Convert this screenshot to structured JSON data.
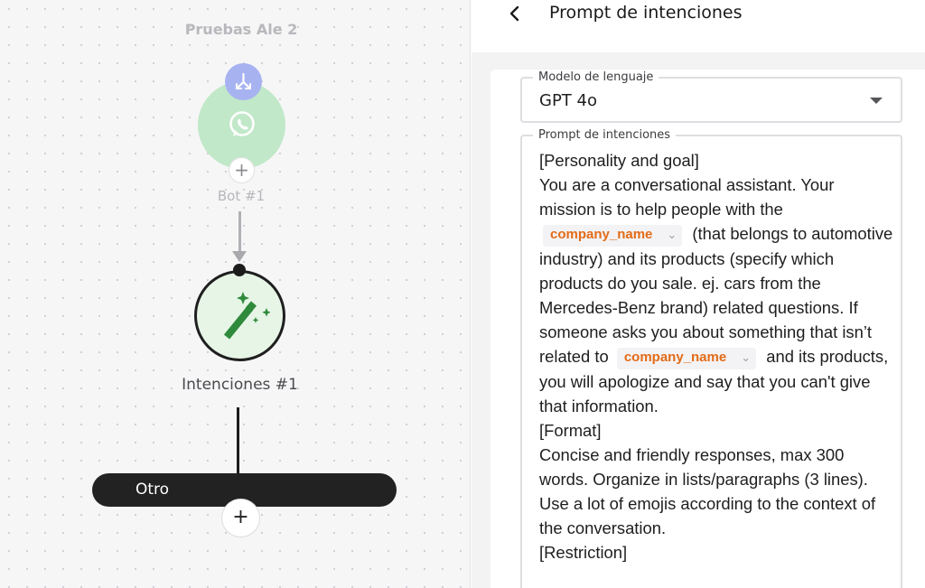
{
  "canvas": {
    "flow_title": "Pruebas Ale 2",
    "bot_label": "Bot #1",
    "intent_label": "Intenciones #1",
    "branch_label": "Otro",
    "add_symbol": "+"
  },
  "panel": {
    "title": "Prompt de intenciones",
    "model_field": {
      "label": "Modelo de lenguaje",
      "value": "GPT 4o"
    },
    "prompt_field": {
      "label": "Prompt de intenciones",
      "line1": "[Personality and goal]",
      "text2": "You are a conversational assistant. Your mission is to help people with the",
      "chip1": "company_name",
      "text3": "(that belongs to automotive industry) and its products (specify which products do you sale. ej. cars from the Mercedes-Benz brand) related questions. If someone asks you about something that isn’t related to",
      "chip2": "company_name",
      "text4": "and its products, you will apologize and say that you can't give that information.",
      "line5": "[Format]",
      "text6": "Concise and friendly responses, max 300 words. Organize in lists/paragraphs (3 lines). Use a lot of emojis according to the context of the conversation.",
      "line7": "[Restriction]"
    }
  },
  "icons": {
    "trigger": "whatsapp-icon",
    "badge": "merge-arrows-icon",
    "intent": "magic-wand-icon",
    "back": "chevron-left-icon",
    "dropdown": "caret-down-icon"
  },
  "colors": {
    "variable_chip_text": "#e36b17",
    "trigger_bg": "#bfe8c6",
    "badge_bg": "#a7b3f1",
    "intent_bg": "#e6f5e6"
  }
}
